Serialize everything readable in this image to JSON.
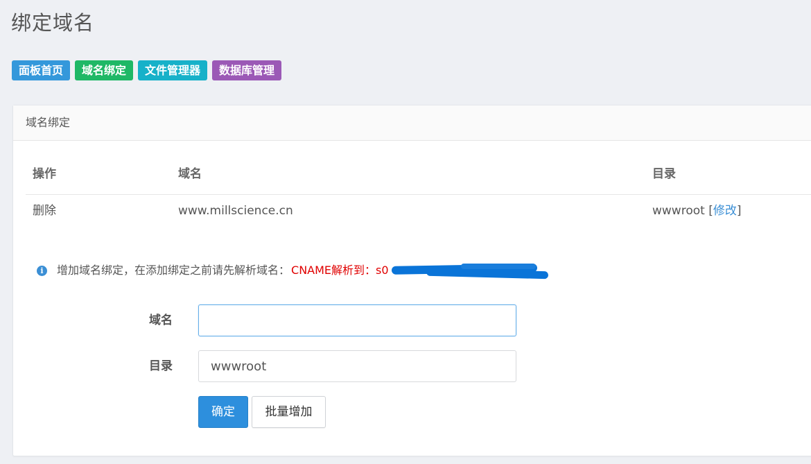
{
  "page": {
    "title": "绑定域名"
  },
  "nav": [
    {
      "label": "面板首页",
      "color": "#3498db"
    },
    {
      "label": "域名绑定",
      "color": "#1fb866"
    },
    {
      "label": "文件管理器",
      "color": "#17b1c9"
    },
    {
      "label": "数据库管理",
      "color": "#9b59b6"
    }
  ],
  "panel": {
    "heading": "域名绑定"
  },
  "table": {
    "headers": {
      "action": "操作",
      "domain": "域名",
      "dir": "目录"
    },
    "rows": [
      {
        "action": "删除",
        "domain": "www.millscience.cn",
        "dir": "wwwroot",
        "edit_open": "[",
        "edit": "修改",
        "edit_close": "]"
      }
    ]
  },
  "notice": {
    "text": "增加域名绑定，在添加绑定之前请先解析域名：",
    "cname": "CNAME解析到：",
    "cname_prefix": "s0"
  },
  "form": {
    "domain_label": "域名",
    "domain_value": "",
    "dir_label": "目录",
    "dir_value": "wwwroot",
    "submit_label": "确定",
    "batch_label": "批量增加"
  }
}
